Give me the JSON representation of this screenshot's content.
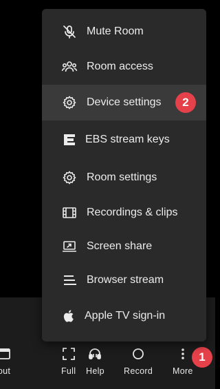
{
  "menu": {
    "items": [
      {
        "label": "Mute Room",
        "icon": "mic-off-icon"
      },
      {
        "label": "Room access",
        "icon": "users-icon"
      },
      {
        "label": "Device settings",
        "icon": "gear-icon",
        "active": true
      },
      {
        "label": "EBS stream keys",
        "icon": "ebs-logo-icon"
      },
      {
        "label": "Room settings",
        "icon": "gear-icon"
      },
      {
        "label": "Recordings & clips",
        "icon": "film-icon"
      },
      {
        "label": "Screen share",
        "icon": "screen-share-icon"
      },
      {
        "label": "Browser stream",
        "icon": "lines-icon"
      },
      {
        "label": "Apple TV sign-in",
        "icon": "apple-icon"
      }
    ]
  },
  "toolbar": {
    "layout_label": "out",
    "full_label": "Full",
    "help_label": "Help",
    "record_label": "Record",
    "more_label": "More"
  },
  "badges": {
    "more_step": "1",
    "device_settings_step": "2"
  },
  "colors": {
    "badge": "#e5414a",
    "menu_bg": "#2a2a2a",
    "active_item_bg": "#3a3a3a"
  }
}
